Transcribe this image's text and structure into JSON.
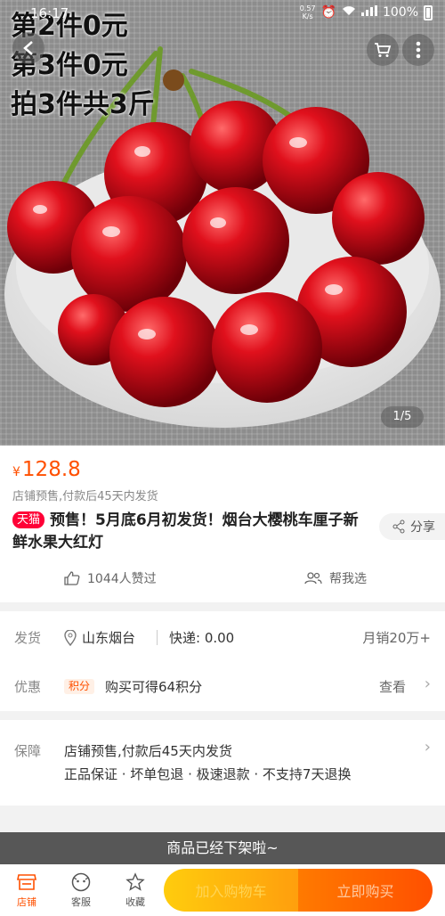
{
  "status_bar": {
    "time": "16:17",
    "speed_top": "0.57",
    "speed_unit": "K/s",
    "battery": "100%"
  },
  "hero": {
    "promo_lines": [
      "第2件0元",
      "第3件0元",
      "拍3件共3斤"
    ],
    "pager": "1/5",
    "icons": {
      "back": "back-arrow-icon",
      "cart": "cart-icon",
      "more": "more-dots-icon"
    }
  },
  "product": {
    "currency": "¥",
    "price": "128.8",
    "presale_note": "店铺预售,付款后45天内发货",
    "badge": "天猫",
    "title": "预售！5月底6月初发货！烟台大樱桃车厘子新鲜水果大红灯",
    "share_label": "分享",
    "likes_label": "1044人赞过",
    "help_label": "帮我选"
  },
  "shipping": {
    "label": "发货",
    "location": "山东烟台",
    "fee": "快递: 0.00",
    "monthly_sales": "月销20万+"
  },
  "promotion": {
    "label": "优惠",
    "tag": "积分",
    "text": "购买可得64积分",
    "link": "查看"
  },
  "guarantee": {
    "label": "保障",
    "line1": "店铺预售,付款后45天内发货",
    "line2": "正品保证 · 坏单包退 · 极速退款 · 不支持7天退换"
  },
  "notice": "商品已经下架啦~",
  "bottom_bar": {
    "store": "店铺",
    "service": "客服",
    "favorite": "收藏",
    "add_to_cart": "加入购物车",
    "buy_now": "立即购买"
  },
  "colors": {
    "accent": "#ff5000",
    "tmall": "#ff0036",
    "cart_btn": "#ffb300"
  }
}
